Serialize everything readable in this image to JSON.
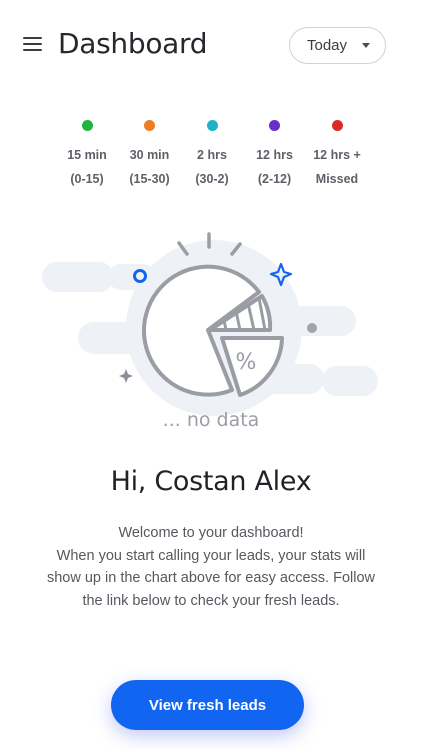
{
  "header": {
    "title": "Dashboard",
    "menu_icon": "hamburger-menu-icon",
    "period_select": {
      "value": "Today",
      "icon": "caret-down-icon"
    }
  },
  "legend": [
    {
      "label": "15 min",
      "range": "(0-15)",
      "color": "#1fb53f"
    },
    {
      "label": "30 min",
      "range": "(15-30)",
      "color": "#f07b22"
    },
    {
      "label": "2 hrs",
      "range": "(30-2)",
      "color": "#1fb2c4"
    },
    {
      "label": "12 hrs",
      "range": "(2-12)",
      "color": "#6a2fc6"
    },
    {
      "label": "12 hrs +",
      "range": "Missed",
      "color": "#d92a2a"
    }
  ],
  "illustration": {
    "icon": "empty-pie-chart-icon",
    "percent_symbol": "%",
    "empty_text": "... no data"
  },
  "greeting": "Hi, Costan Alex",
  "description": {
    "line1": "Welcome to your dashboard!",
    "line2": "When you start calling your leads, your stats will show up in the chart above for easy access. Follow the link below to check your fresh leads."
  },
  "cta": {
    "label": "View fresh leads",
    "color": "#1265f0"
  }
}
